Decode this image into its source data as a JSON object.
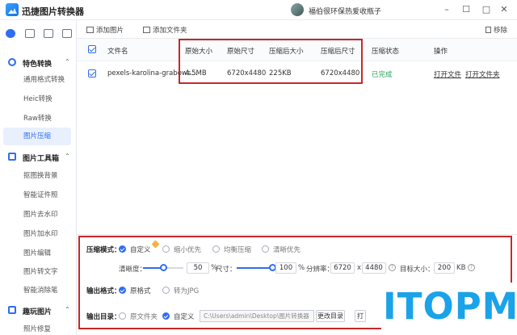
{
  "app": {
    "title": "迅捷图片转换器",
    "user": "福伯很环保热爱收瓶子"
  },
  "window": {
    "minimize": "–",
    "restore": "☐",
    "maximize": "□",
    "close": "✕"
  },
  "sidebar": {
    "sections": [
      {
        "label": "特色转换",
        "items": [
          "通用格式转换",
          "Heic转换",
          "Raw转换",
          "图片压缩"
        ]
      },
      {
        "label": "图片工具箱",
        "items": [
          "抠图换背景",
          "智能证件照",
          "图片去水印",
          "图片加水印",
          "图片编辑",
          "图片转文字",
          "智能消除笔"
        ]
      },
      {
        "label": "趣玩图片",
        "items": [
          "照片修复"
        ]
      }
    ],
    "active_item": "图片压缩"
  },
  "toolbar": {
    "add_image": "添加图片",
    "add_folder": "添加文件夹",
    "remove": "移除"
  },
  "table": {
    "headers": [
      "文件名",
      "原始大小",
      "原始尺寸",
      "压缩后大小",
      "压缩后尺寸",
      "压缩状态",
      "操作"
    ],
    "rows": [
      {
        "name": "pexels-karolina-grabows...",
        "orig_size": "4.5MB",
        "orig_dim": "6720x4480",
        "comp_size": "225KB",
        "comp_dim": "6720x4480",
        "status": "已完成",
        "open_file": "打开文件",
        "open_folder": "打开文件夹"
      }
    ]
  },
  "settings": {
    "mode_label": "压缩模式：",
    "modes": [
      "自定义",
      "缩小优先",
      "均衡压缩",
      "清晰优先"
    ],
    "clarity_label": "清晰度：",
    "clarity_value": "50",
    "clarity_unit": "%",
    "size_label": "尺寸：",
    "size_value": "100",
    "size_unit": "%",
    "resolution_label": "分辨率：",
    "res_w": "6720",
    "res_x": "x",
    "res_h": "4480",
    "target_label": "目标大小：",
    "target_value": "200",
    "target_unit": "KB",
    "format_label": "输出格式：",
    "formats": [
      "原格式",
      "转为JPG"
    ],
    "dir_label": "输出目录：",
    "dirs": [
      "原文件夹",
      "自定义"
    ],
    "path": "C:\\Users\\admin\\Desktop\\图片转换器",
    "change_dir": "更改目录",
    "open_btn": "打"
  },
  "watermark": "ITOPM",
  "colors": {
    "accent": "#2f6df2",
    "done": "#26a65b",
    "highlight": "#c62828",
    "watermark": "#1aa3e8"
  }
}
